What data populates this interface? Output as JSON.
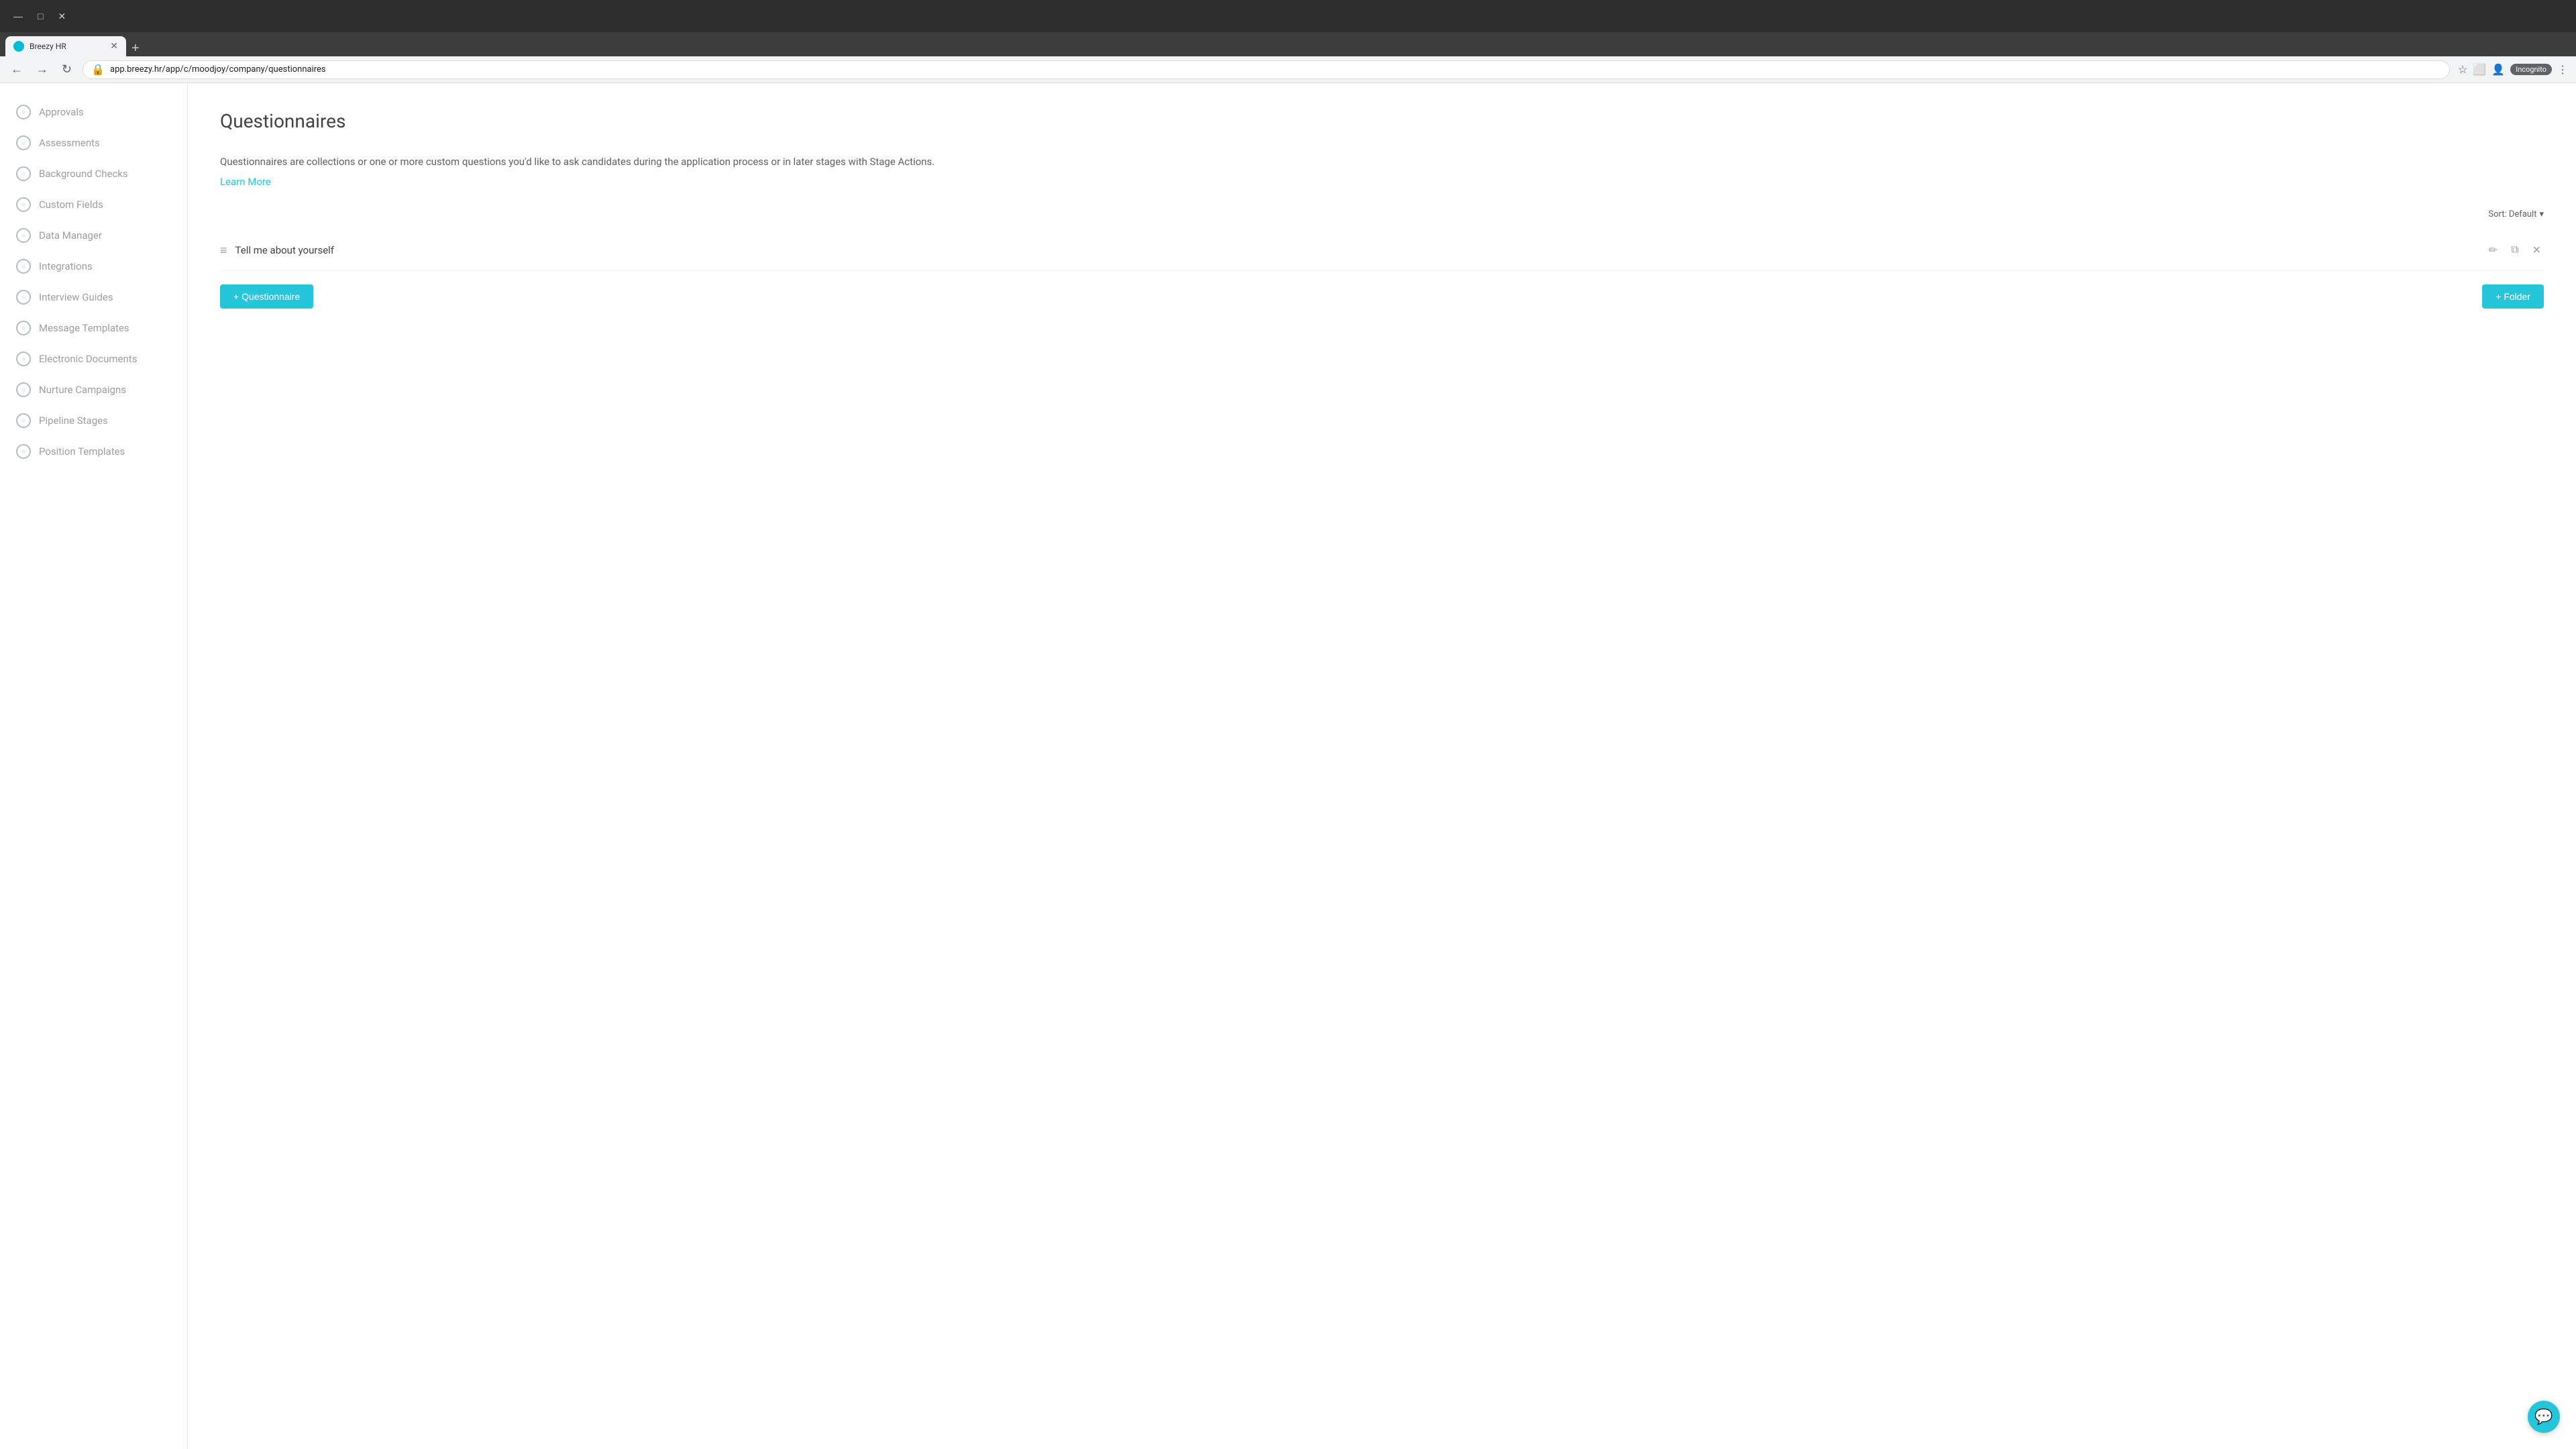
{
  "browser": {
    "tab_title": "Breezy HR",
    "url": "app.breezy.hr/app/c/moodjoy/company/questionnaires",
    "incognito_label": "Incognito"
  },
  "sidebar": {
    "items": [
      {
        "id": "approvals",
        "label": "Approvals"
      },
      {
        "id": "assessments",
        "label": "Assessments"
      },
      {
        "id": "background-checks",
        "label": "Background Checks"
      },
      {
        "id": "custom-fields",
        "label": "Custom Fields"
      },
      {
        "id": "data-manager",
        "label": "Data Manager"
      },
      {
        "id": "integrations",
        "label": "Integrations"
      },
      {
        "id": "interview-guides",
        "label": "Interview Guides"
      },
      {
        "id": "message-templates",
        "label": "Message Templates"
      },
      {
        "id": "electronic-documents",
        "label": "Electronic Documents"
      },
      {
        "id": "nurture-campaigns",
        "label": "Nurture Campaigns"
      },
      {
        "id": "pipeline-stages",
        "label": "Pipeline Stages"
      },
      {
        "id": "position-templates",
        "label": "Position Templates"
      }
    ]
  },
  "main": {
    "page_title": "Questionnaires",
    "description": "Questionnaires are collections or one or more custom questions you'd like to ask candidates during the application process or in later stages with Stage Actions.",
    "learn_more_label": "Learn More",
    "sort_label": "Sort: Default",
    "questionnaires": [
      {
        "id": "q1",
        "name": "Tell me about yourself"
      }
    ],
    "add_questionnaire_label": "+ Questionnaire",
    "add_folder_label": "+ Folder"
  },
  "colors": {
    "accent": "#26c6da",
    "text_primary": "#424242",
    "text_secondary": "#616161",
    "text_muted": "#9e9e9e"
  }
}
